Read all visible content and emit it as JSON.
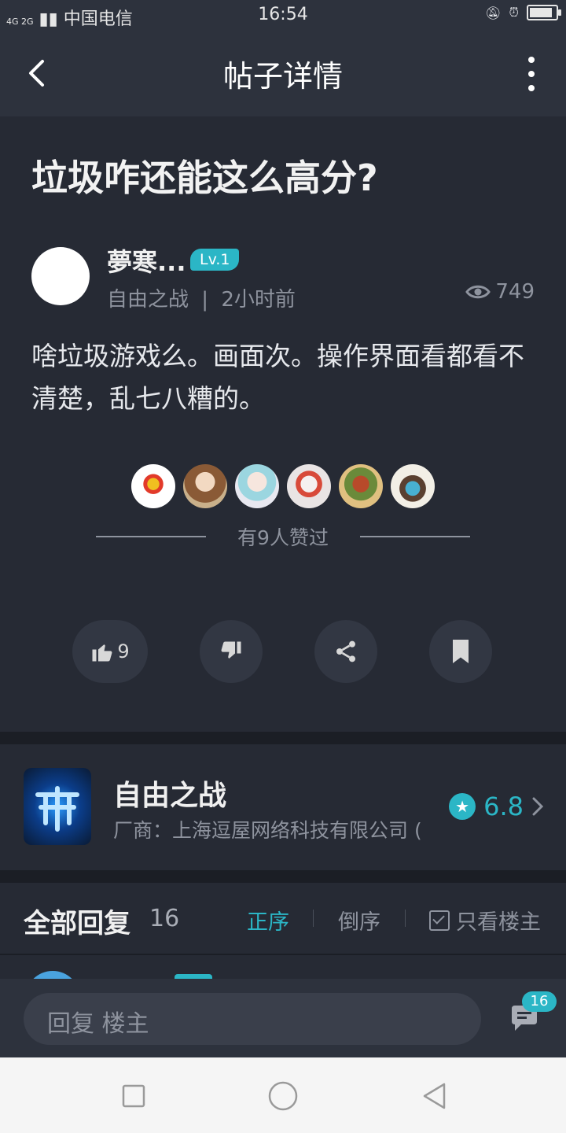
{
  "status_bar": {
    "network": "4G 2G",
    "carrier": "中国电信",
    "time": "16:54"
  },
  "header": {
    "title": "帖子详情"
  },
  "post": {
    "title": "垃圾咋还能这么高分?",
    "author": "夢寒...",
    "level": "Lv.1",
    "game": "自由之战",
    "separator": "|",
    "time_ago": "2小时前",
    "views": "749",
    "content": "啥垃圾游戏么。画面次。操作界面看都看不清楚，乱七八糟的。",
    "likes_text": "有9人赞过",
    "like_count": "9"
  },
  "game_card": {
    "name": "自由之战",
    "vendor": "厂商：上海逗屋网络科技有限公司 (",
    "rating": "6.8"
  },
  "replies": {
    "title": "全部回复",
    "count": "16",
    "sort_asc": "正序",
    "sort_desc": "倒序",
    "only_op": "只看楼主"
  },
  "reply_bar": {
    "placeholder": "回复  楼主",
    "comment_count": "16"
  },
  "colors": {
    "accent": "#2bb6c6",
    "background": "#262a34",
    "header": "#2d323d"
  }
}
